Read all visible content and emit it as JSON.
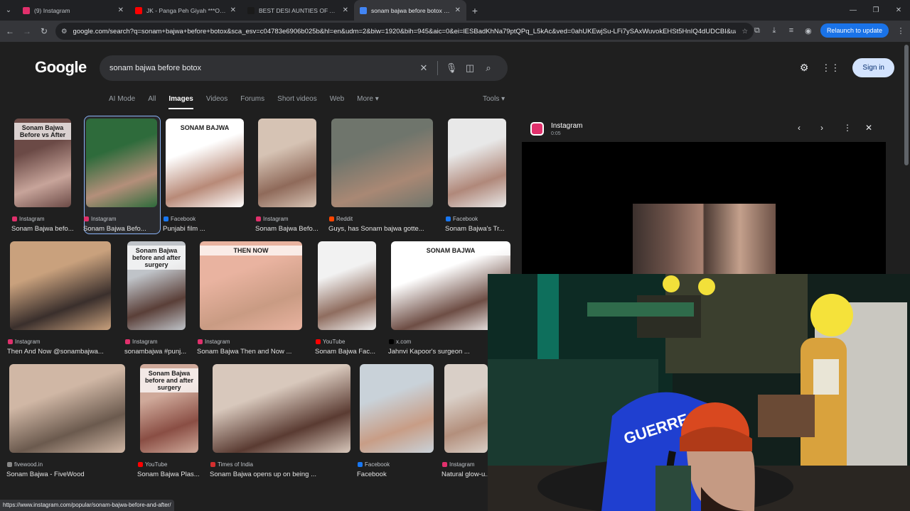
{
  "tabs": [
    {
      "title": "(9) Instagram",
      "fav": "#e1306c",
      "active": false
    },
    {
      "title": "JK - Panga Peh Giyah ***Official",
      "fav": "#ff0000",
      "active": false
    },
    {
      "title": "BEST DESI AUNTIES OF ALL TIM",
      "fav": "#1a1a1a",
      "active": false
    },
    {
      "title": "sonam bajwa before botox - Go",
      "fav": "#4285f4",
      "active": true
    }
  ],
  "address": {
    "url": "google.com/search?q=sonam+bajwa+before+botox&sca_esv=c04783e6906b025b&hl=en&udm=2&biw=1920&bih=945&aic=0&ei=lESBadKhNa79ptQPq_L5kAc&ved=0ahUKEwjSu-LFi7ySAxWuvokEHSt5HnIQ4dUDCBI&uact...",
    "relaunch": "Relaunch to update"
  },
  "google": {
    "logo": "Google",
    "query": "sonam bajwa before botox",
    "sign_in": "Sign in",
    "filters": [
      "AI Mode",
      "All",
      "Images",
      "Videos",
      "Forums",
      "Short videos",
      "Web",
      "More ▾"
    ],
    "tools": "Tools ▾"
  },
  "results": [
    {
      "src": "Instagram",
      "cap": "Sonam Bajwa befo...",
      "c": "#e1306c",
      "thumb": "#6b4a46",
      "thumb2": "#c7a49a",
      "text": "Sonam Bajwa Before vs After"
    },
    {
      "src": "Instagram",
      "cap": "Sonam Bajwa Befo...",
      "c": "#e1306c",
      "thumb": "#2e6b3b",
      "thumb2": "#b48f7a",
      "text": ""
    },
    {
      "src": "Facebook",
      "cap": "Punjabi film ...",
      "c": "#1877f2",
      "thumb": "#ffffff",
      "thumb2": "#b88a78",
      "text": "SONAM BAJWA"
    },
    {
      "src": "Instagram",
      "cap": "Sonam Bajwa Befo...",
      "c": "#e1306c",
      "thumb": "#d6c3b4",
      "thumb2": "#8f6a5a",
      "text": ""
    },
    {
      "src": "Reddit",
      "cap": "Guys, has Sonam bajwa gotte...",
      "c": "#ff4500",
      "thumb": "#6f756c",
      "thumb2": "#a98874",
      "text": ""
    },
    {
      "src": "Facebook",
      "cap": "Sonam Bajwa's Tr...",
      "c": "#1877f2",
      "thumb": "#e8e8e8",
      "thumb2": "#b0887a",
      "text": ""
    },
    {
      "src": "Instagram",
      "cap": "Then And Now @sonambajwa...",
      "c": "#e1306c",
      "thumb": "#c9a17d",
      "thumb2": "#3a2f2c",
      "text": ""
    },
    {
      "src": "Instagram",
      "cap": "sonambajwa #punj...",
      "c": "#e1306c",
      "thumb": "#bfc3c8",
      "thumb2": "#5a3f38",
      "text": "Sonam Bajwa before and after surgery"
    },
    {
      "src": "Instagram",
      "cap": "Sonam Bajwa Then and Now ...",
      "c": "#e1306c",
      "thumb": "#e9b3a0",
      "thumb2": "#c99b83",
      "text": "THEN  NOW"
    },
    {
      "src": "YouTube",
      "cap": "Sonam Bajwa Fac...",
      "c": "#ff0000",
      "thumb": "#f2f2f2",
      "thumb2": "#8f6d5f",
      "text": ""
    },
    {
      "src": "x.com",
      "cap": "Jahnvi Kapoor's surgeon ...",
      "c": "#000000",
      "thumb": "#ffffff",
      "thumb2": "#6e4e45",
      "text": "SONAM BAJWA"
    },
    {
      "src": "fivewood.in",
      "cap": "Sonam Bajwa - FiveWood",
      "c": "#888888",
      "thumb": "#d0b7a5",
      "thumb2": "#6b5a4e",
      "text": ""
    },
    {
      "src": "YouTube",
      "cap": "Sonam Bajwa Plas...",
      "c": "#ff0000",
      "thumb": "#cfa99a",
      "thumb2": "#8a4e44",
      "text": "Sonam Bajwa before and after surgery"
    },
    {
      "src": "Times of India",
      "cap": "Sonam Bajwa opens up on being ...",
      "c": "#d32f2f",
      "thumb": "#d8c8bc",
      "thumb2": "#5a3b32",
      "text": ""
    },
    {
      "src": "Facebook",
      "cap": "Facebook",
      "c": "#1877f2",
      "thumb": "#c9d2d9",
      "thumb2": "#c89d86",
      "text": ""
    },
    {
      "src": "Instagram",
      "cap": "Natural glow-u...",
      "c": "#e1306c",
      "thumb": "#d9cfc7",
      "thumb2": "#b38f7c",
      "text": ""
    }
  ],
  "labels": {
    "then": "Then And Now",
    "then_now_row3": "SONAM BAJWA",
    "then_and_now": "Then And Now",
    "sonam_bajwa": "SONAM BAJWA"
  },
  "panel": {
    "title": "Instagram",
    "time": "0:05"
  },
  "status_url": "https://www.instagram.com/popular/sonam-bajwa-before-and-after/",
  "webcam": {
    "jersey": "GUERRE",
    "colors": {
      "wall": "#0f2a22",
      "jersey": "#1f3fd0",
      "beanie": "#d9481f",
      "sign": "#f5e23a"
    }
  }
}
